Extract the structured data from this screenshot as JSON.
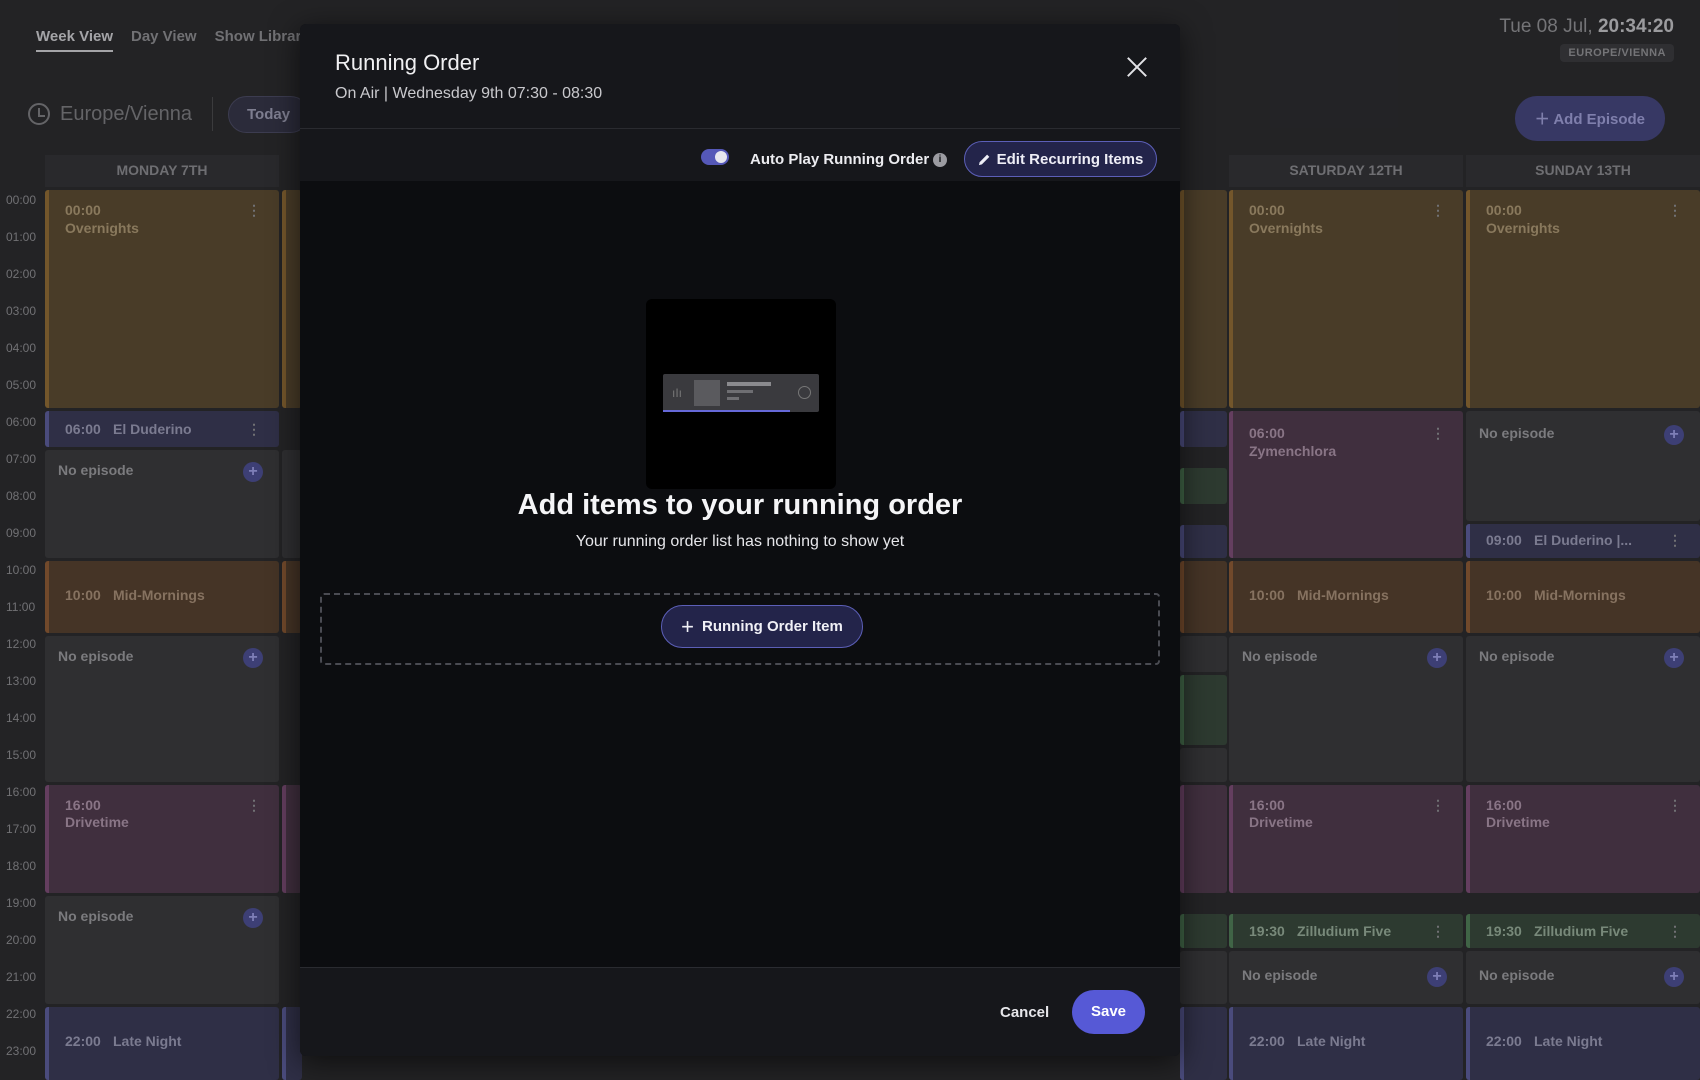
{
  "header": {
    "views": [
      "Week View",
      "Day View",
      "Show Library"
    ],
    "date_prefix": "Tue 08 Jul,",
    "time": "20:34:20",
    "timezone_badge": "EUROPE/VIENNA",
    "timezone": "Europe/Vienna",
    "today_label": "Today",
    "add_episode_label": "Add Episode"
  },
  "hours": [
    "00:00",
    "01:00",
    "02:00",
    "03:00",
    "04:00",
    "05:00",
    "06:00",
    "07:00",
    "08:00",
    "09:00",
    "10:00",
    "11:00",
    "12:00",
    "13:00",
    "14:00",
    "15:00",
    "16:00",
    "17:00",
    "18:00",
    "19:00",
    "20:00",
    "21:00",
    "22:00",
    "23:00"
  ],
  "days": {
    "monday": "MONDAY 7TH",
    "saturday": "SATURDAY 12TH",
    "sunday": "SUNDAY 13TH"
  },
  "monday": {
    "overnights_time": "00:00",
    "overnights_name": "Overnights",
    "duderino_time": "06:00",
    "duderino_name": "El Duderino",
    "no_episode": "No episode",
    "midmornings_time": "10:00",
    "midmornings_name": "Mid-Mornings",
    "drivetime_time": "16:00",
    "drivetime_name": "Drivetime",
    "latenight_time": "22:00",
    "latenight_name": "Late Night"
  },
  "saturday": {
    "overnights_time": "00:00",
    "overnights_name": "Overnights",
    "zym_time": "06:00",
    "zym_name": "Zymenchlora",
    "midmornings_time": "10:00",
    "midmornings_name": "Mid-Mornings",
    "no_episode": "No episode",
    "drivetime_time": "16:00",
    "drivetime_name": "Drivetime",
    "zill_time": "19:30",
    "zill_name": "Zilludium Five",
    "latenight_time": "22:00",
    "latenight_name": "Late Night"
  },
  "sunday": {
    "overnights_time": "00:00",
    "overnights_name": "Overnights",
    "no_episode": "No episode",
    "duderino_time": "09:00",
    "duderino_name": "El Duderino |...",
    "midmornings_time": "10:00",
    "midmornings_name": "Mid-Mornings",
    "drivetime_time": "16:00",
    "drivetime_name": "Drivetime",
    "zill_time": "19:30",
    "zill_name": "Zilludium Five",
    "latenight_time": "22:00",
    "latenight_name": "Late Night"
  },
  "modal": {
    "title": "Running Order",
    "subtitle": "On Air  |  Wednesday 9th 07:30 - 08:30",
    "auto_play_label": "Auto Play Running Order",
    "auto_play_on": true,
    "edit_recurring_label": "Edit Recurring Items",
    "empty_title": "Add items to your running order",
    "empty_subtitle": "Your running order list has nothing to show yet",
    "add_item_label": "Running Order Item",
    "cancel_label": "Cancel",
    "save_label": "Save",
    "accent": "#5659d6"
  }
}
